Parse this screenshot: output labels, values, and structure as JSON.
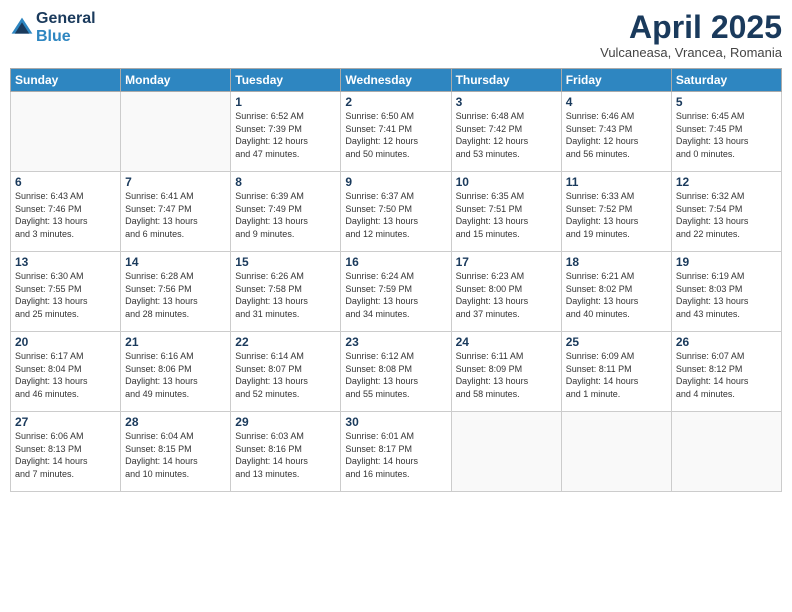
{
  "logo": {
    "general": "General",
    "blue": "Blue"
  },
  "title": "April 2025",
  "location": "Vulcaneasa, Vrancea, Romania",
  "weekdays": [
    "Sunday",
    "Monday",
    "Tuesday",
    "Wednesday",
    "Thursday",
    "Friday",
    "Saturday"
  ],
  "weeks": [
    [
      {
        "day": "",
        "info": ""
      },
      {
        "day": "",
        "info": ""
      },
      {
        "day": "1",
        "info": "Sunrise: 6:52 AM\nSunset: 7:39 PM\nDaylight: 12 hours\nand 47 minutes."
      },
      {
        "day": "2",
        "info": "Sunrise: 6:50 AM\nSunset: 7:41 PM\nDaylight: 12 hours\nand 50 minutes."
      },
      {
        "day": "3",
        "info": "Sunrise: 6:48 AM\nSunset: 7:42 PM\nDaylight: 12 hours\nand 53 minutes."
      },
      {
        "day": "4",
        "info": "Sunrise: 6:46 AM\nSunset: 7:43 PM\nDaylight: 12 hours\nand 56 minutes."
      },
      {
        "day": "5",
        "info": "Sunrise: 6:45 AM\nSunset: 7:45 PM\nDaylight: 13 hours\nand 0 minutes."
      }
    ],
    [
      {
        "day": "6",
        "info": "Sunrise: 6:43 AM\nSunset: 7:46 PM\nDaylight: 13 hours\nand 3 minutes."
      },
      {
        "day": "7",
        "info": "Sunrise: 6:41 AM\nSunset: 7:47 PM\nDaylight: 13 hours\nand 6 minutes."
      },
      {
        "day": "8",
        "info": "Sunrise: 6:39 AM\nSunset: 7:49 PM\nDaylight: 13 hours\nand 9 minutes."
      },
      {
        "day": "9",
        "info": "Sunrise: 6:37 AM\nSunset: 7:50 PM\nDaylight: 13 hours\nand 12 minutes."
      },
      {
        "day": "10",
        "info": "Sunrise: 6:35 AM\nSunset: 7:51 PM\nDaylight: 13 hours\nand 15 minutes."
      },
      {
        "day": "11",
        "info": "Sunrise: 6:33 AM\nSunset: 7:52 PM\nDaylight: 13 hours\nand 19 minutes."
      },
      {
        "day": "12",
        "info": "Sunrise: 6:32 AM\nSunset: 7:54 PM\nDaylight: 13 hours\nand 22 minutes."
      }
    ],
    [
      {
        "day": "13",
        "info": "Sunrise: 6:30 AM\nSunset: 7:55 PM\nDaylight: 13 hours\nand 25 minutes."
      },
      {
        "day": "14",
        "info": "Sunrise: 6:28 AM\nSunset: 7:56 PM\nDaylight: 13 hours\nand 28 minutes."
      },
      {
        "day": "15",
        "info": "Sunrise: 6:26 AM\nSunset: 7:58 PM\nDaylight: 13 hours\nand 31 minutes."
      },
      {
        "day": "16",
        "info": "Sunrise: 6:24 AM\nSunset: 7:59 PM\nDaylight: 13 hours\nand 34 minutes."
      },
      {
        "day": "17",
        "info": "Sunrise: 6:23 AM\nSunset: 8:00 PM\nDaylight: 13 hours\nand 37 minutes."
      },
      {
        "day": "18",
        "info": "Sunrise: 6:21 AM\nSunset: 8:02 PM\nDaylight: 13 hours\nand 40 minutes."
      },
      {
        "day": "19",
        "info": "Sunrise: 6:19 AM\nSunset: 8:03 PM\nDaylight: 13 hours\nand 43 minutes."
      }
    ],
    [
      {
        "day": "20",
        "info": "Sunrise: 6:17 AM\nSunset: 8:04 PM\nDaylight: 13 hours\nand 46 minutes."
      },
      {
        "day": "21",
        "info": "Sunrise: 6:16 AM\nSunset: 8:06 PM\nDaylight: 13 hours\nand 49 minutes."
      },
      {
        "day": "22",
        "info": "Sunrise: 6:14 AM\nSunset: 8:07 PM\nDaylight: 13 hours\nand 52 minutes."
      },
      {
        "day": "23",
        "info": "Sunrise: 6:12 AM\nSunset: 8:08 PM\nDaylight: 13 hours\nand 55 minutes."
      },
      {
        "day": "24",
        "info": "Sunrise: 6:11 AM\nSunset: 8:09 PM\nDaylight: 13 hours\nand 58 minutes."
      },
      {
        "day": "25",
        "info": "Sunrise: 6:09 AM\nSunset: 8:11 PM\nDaylight: 14 hours\nand 1 minute."
      },
      {
        "day": "26",
        "info": "Sunrise: 6:07 AM\nSunset: 8:12 PM\nDaylight: 14 hours\nand 4 minutes."
      }
    ],
    [
      {
        "day": "27",
        "info": "Sunrise: 6:06 AM\nSunset: 8:13 PM\nDaylight: 14 hours\nand 7 minutes."
      },
      {
        "day": "28",
        "info": "Sunrise: 6:04 AM\nSunset: 8:15 PM\nDaylight: 14 hours\nand 10 minutes."
      },
      {
        "day": "29",
        "info": "Sunrise: 6:03 AM\nSunset: 8:16 PM\nDaylight: 14 hours\nand 13 minutes."
      },
      {
        "day": "30",
        "info": "Sunrise: 6:01 AM\nSunset: 8:17 PM\nDaylight: 14 hours\nand 16 minutes."
      },
      {
        "day": "",
        "info": ""
      },
      {
        "day": "",
        "info": ""
      },
      {
        "day": "",
        "info": ""
      }
    ]
  ]
}
